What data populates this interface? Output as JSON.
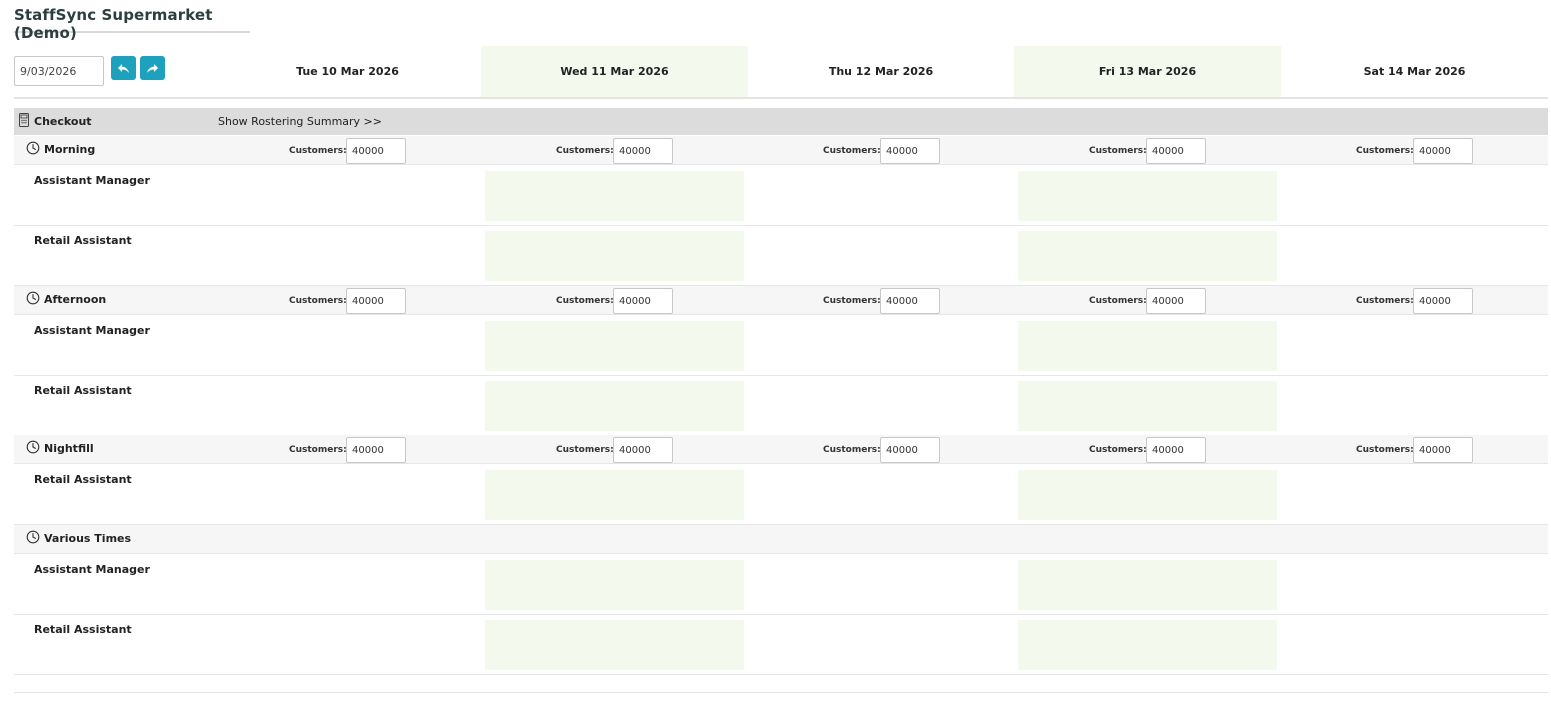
{
  "app": {
    "title": "StaffSync Supermarket (Demo)"
  },
  "toolbar": {
    "date_value": "9/03/2026",
    "prev_icon": "reply-arrow-icon",
    "next_icon": "forward-arrow-icon",
    "accent_color": "#1ea1bd"
  },
  "days": [
    {
      "label": "Tue 10 Mar 2026",
      "highlight": false
    },
    {
      "label": "Wed 11 Mar 2026",
      "highlight": true
    },
    {
      "label": "Thu 12 Mar 2026",
      "highlight": false
    },
    {
      "label": "Fri 13 Mar 2026",
      "highlight": true
    },
    {
      "label": "Sat 14 Mar 2026",
      "highlight": false
    }
  ],
  "department": {
    "name": "Checkout",
    "icon": "register-icon",
    "summary_link": "Show Rostering Summary >>"
  },
  "customers_label": "Customers:",
  "highlight_color": "#f4f9ee",
  "shifts": [
    {
      "name": "Morning",
      "icon": "clock-icon",
      "has_customers": true,
      "customers": [
        "40000",
        "40000",
        "40000",
        "40000",
        "40000"
      ],
      "roles": [
        "Assistant Manager",
        "Retail Assistant"
      ]
    },
    {
      "name": "Afternoon",
      "icon": "clock-icon",
      "has_customers": true,
      "customers": [
        "40000",
        "40000",
        "40000",
        "40000",
        "40000"
      ],
      "roles": [
        "Assistant Manager",
        "Retail Assistant"
      ]
    },
    {
      "name": "Nightfill",
      "icon": "clock-icon",
      "has_customers": true,
      "customers": [
        "40000",
        "40000",
        "40000",
        "40000",
        "40000"
      ],
      "roles": [
        "Retail Assistant"
      ]
    },
    {
      "name": "Various Times",
      "icon": "clock-icon",
      "has_customers": false,
      "customers": [],
      "roles": [
        "Assistant Manager",
        "Retail Assistant"
      ]
    }
  ]
}
